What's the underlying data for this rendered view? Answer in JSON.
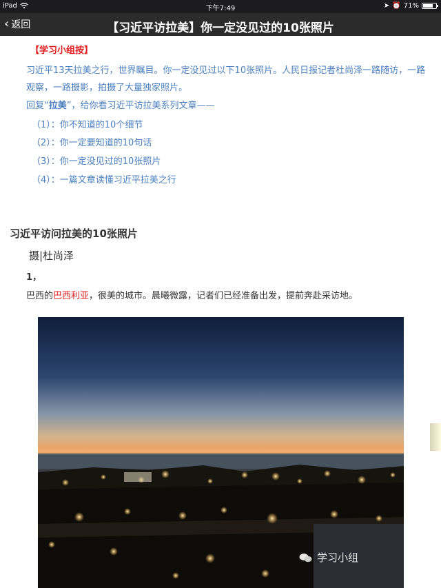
{
  "status": {
    "device": "iPad",
    "time": "下午7:49",
    "battery": "71%"
  },
  "nav": {
    "back_label": "返回",
    "title": "【习近平访拉美】你一定没见过的10张照片"
  },
  "article": {
    "tag": "【学习小组按】",
    "intro": "习近平13天拉美之行，世界瞩目。你一定没见过以下10张照片。人民日报记者杜尚泽一路随访，一路观察，一路摄影，拍摄了大量独家照片。",
    "reply_prefix": "回复“",
    "reply_keyword": "拉美",
    "reply_suffix": "”，给你看习近平访拉美系列文章——",
    "series": [
      "（1）：你不知道的10个细节",
      "（2）：你一定要知道的10句话",
      "（3）：你一定没见过的10张照片",
      "（4）：一篇文章读懂习近平拉美之行"
    ],
    "heading": "习近平访问拉美的10张照片",
    "byline": "摄|杜尚泽",
    "photo_number": "1，",
    "caption_prefix": "巴西的",
    "caption_place": "巴西利亚",
    "caption_suffix": "，很美的城市。晨曦微露，记者们已经准备出发，提前奔赴采访地。",
    "watermark": "学习小组"
  },
  "colors": {
    "link_blue": "#4a7fbf",
    "accent_red": "#e02020",
    "nav_bg": "#2b2b2b"
  }
}
